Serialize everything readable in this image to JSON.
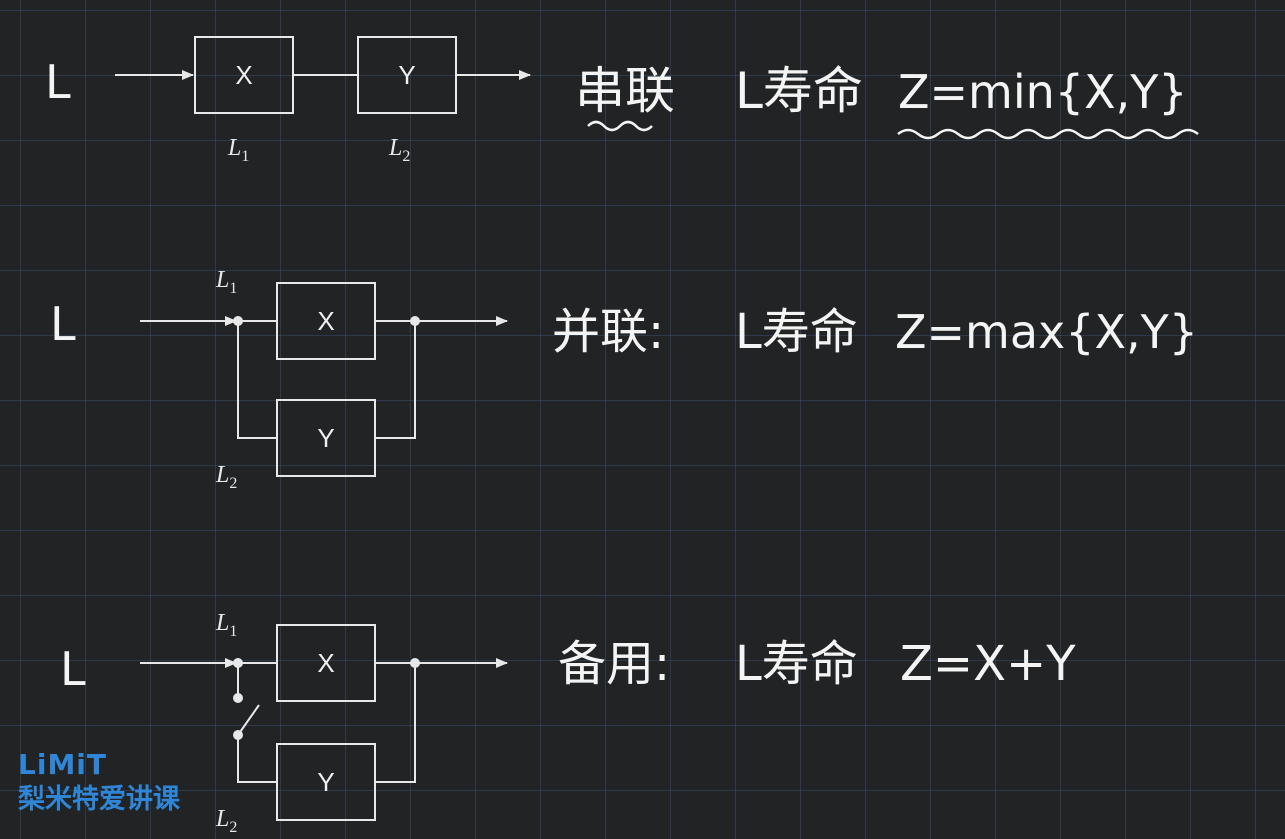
{
  "colors": {
    "background": "#222324",
    "grid": "#46649a",
    "ink": "#f4f4f4",
    "logo": "#2f86d6"
  },
  "sections": [
    {
      "id": "series",
      "lead": "L",
      "boxes": [
        "X",
        "Y"
      ],
      "labels": {
        "l1": "L",
        "l1_sub": "1",
        "l2": "L",
        "l2_sub": "2"
      },
      "note": {
        "type": "串联",
        "life": "L寿命",
        "formula": "Z=min{X,Y}"
      }
    },
    {
      "id": "parallel",
      "lead": "L",
      "boxes": [
        "X",
        "Y"
      ],
      "labels": {
        "l1": "L",
        "l1_sub": "1",
        "l2": "L",
        "l2_sub": "2"
      },
      "note": {
        "type": "并联:",
        "life": "L寿命",
        "formula": "Z=max{X,Y}"
      }
    },
    {
      "id": "standby",
      "lead": "L",
      "boxes": [
        "X",
        "Y"
      ],
      "labels": {
        "l1": "L",
        "l1_sub": "1",
        "l2": "L",
        "l2_sub": "2"
      },
      "note": {
        "type": "备用:",
        "life": "L寿命",
        "formula": "Z=X+Y"
      }
    }
  ],
  "logo": {
    "en": "LiMiT",
    "cn": "梨米特爱讲课"
  }
}
